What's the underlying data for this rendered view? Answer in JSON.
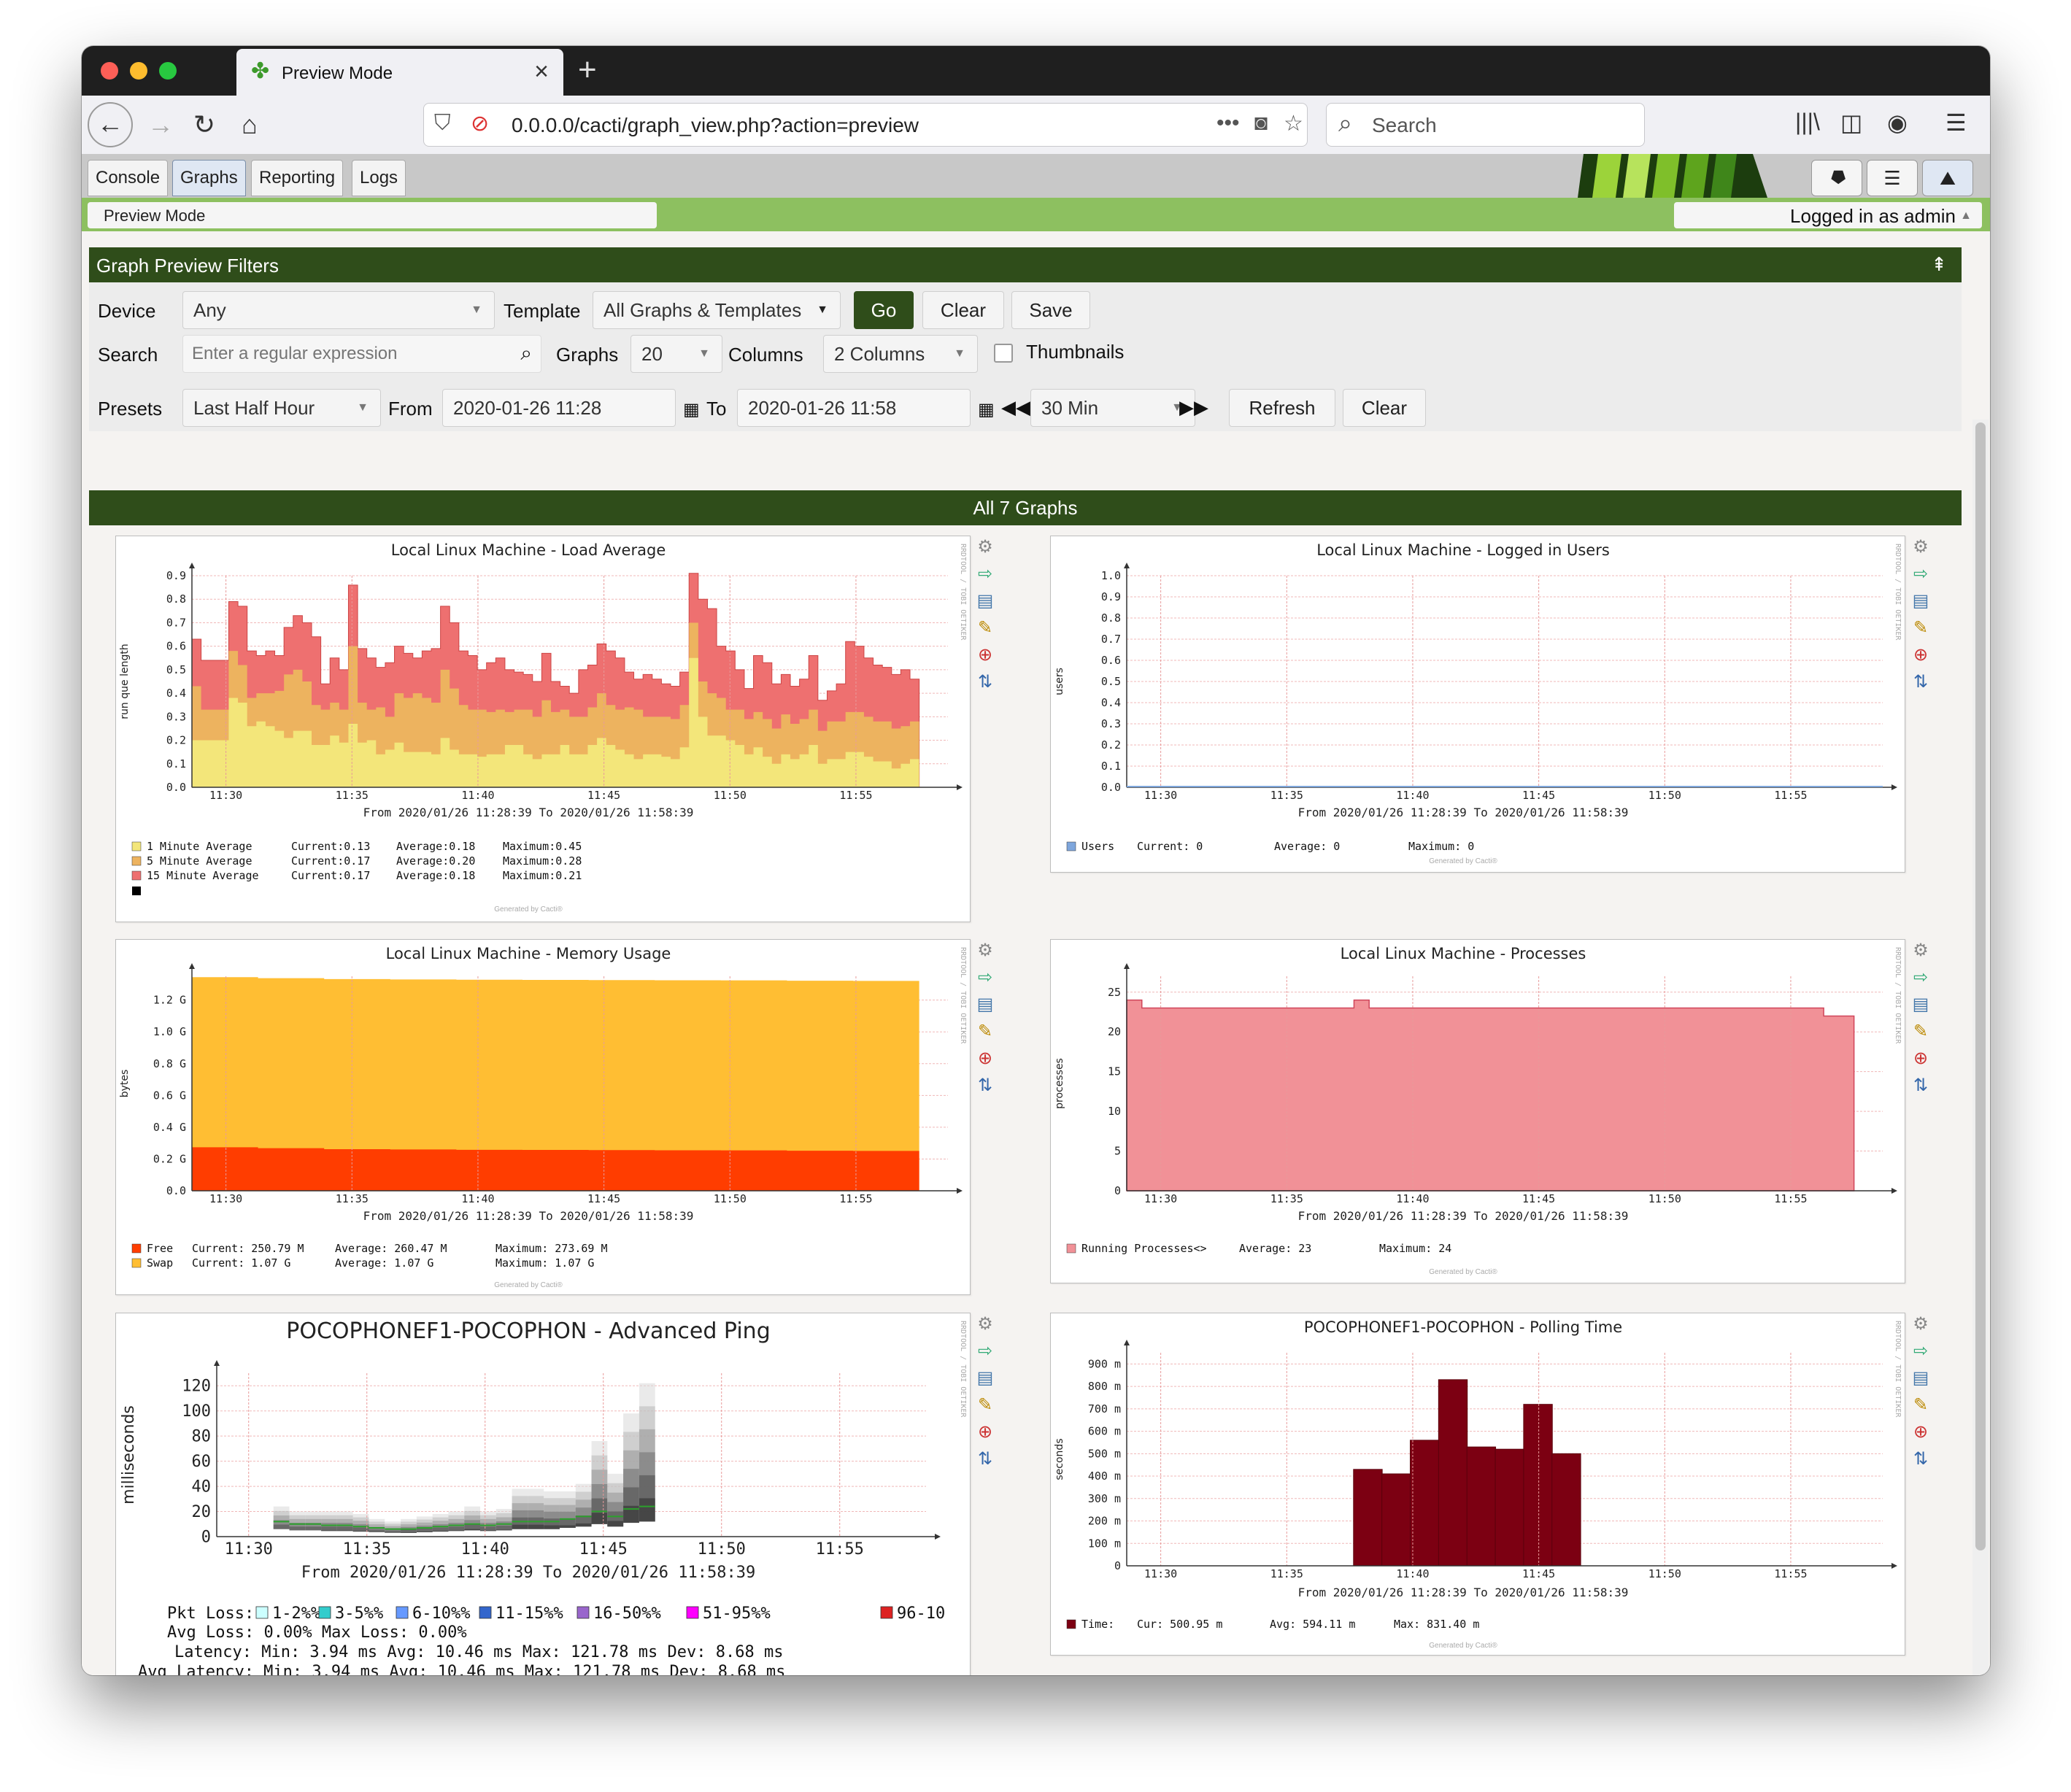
{
  "browser": {
    "tab_title": "Preview Mode",
    "url": "0.0.0.0/cacti/graph_view.php?action=preview",
    "search_placeholder": "Search"
  },
  "cacti": {
    "tabs": [
      "Console",
      "Graphs",
      "Reporting",
      "Logs"
    ],
    "active_tab": "Graphs",
    "breadcrumb": "Preview Mode",
    "login_text": "Logged in as admin"
  },
  "filters": {
    "title": "Graph Preview Filters",
    "device_label": "Device",
    "device_value": "Any",
    "template_label": "Template",
    "template_value": "All Graphs & Templates",
    "go_label": "Go",
    "clear_label": "Clear",
    "save_label": "Save",
    "search_label": "Search",
    "search_placeholder": "Enter a regular expression",
    "graphs_label": "Graphs",
    "graphs_value": "20",
    "columns_label": "Columns",
    "columns_value": "2 Columns",
    "thumbnails_label": "Thumbnails",
    "presets_label": "Presets",
    "presets_value": "Last Half Hour",
    "from_label": "From",
    "from_value": "2020-01-26 11:28",
    "to_label": "To",
    "to_value": "2020-01-26 11:58",
    "span_value": "30 Min",
    "refresh_label": "Refresh",
    "clear2_label": "Clear"
  },
  "graphs_header": "All 7 Graphs",
  "common": {
    "x_ticks": [
      "11:30",
      "11:35",
      "11:40",
      "11:45",
      "11:50",
      "11:55"
    ],
    "range_text": "From 2020/01/26 11:28:39 To 2020/01/26 11:58:39",
    "generated": "Generated by Cacti®",
    "rrdtool": "RRDTOOL / TOBI OETIKER"
  },
  "colors": {
    "load_1": "#F3E67A",
    "load_5": "#EDB35F",
    "load_15": "#EE7070",
    "users": "#7EA6DC",
    "mem_free": "#FF3D00",
    "mem_swap": "#FFBE33",
    "proc": "#F19197",
    "poll": "#7C0012",
    "header_green": "#2F4D1A",
    "bar_green": "#8DC060"
  },
  "chart_data": [
    {
      "type": "area",
      "title": "Local Linux Machine - Load Average",
      "ylabel": "run que length",
      "y_ticks": [
        "0.0",
        "0.1",
        "0.2",
        "0.3",
        "0.4",
        "0.5",
        "0.6",
        "0.7",
        "0.8",
        "0.9"
      ],
      "ylim": [
        0,
        0.9
      ],
      "series": [
        {
          "name": "15 Minute Average",
          "values": [
            0.63,
            0.54,
            0.54,
            0.54,
            0.79,
            0.77,
            0.58,
            0.56,
            0.58,
            0.56,
            0.68,
            0.73,
            0.7,
            0.64,
            0.44,
            0.55,
            0.5,
            0.86,
            0.59,
            0.55,
            0.51,
            0.53,
            0.6,
            0.57,
            0.55,
            0.58,
            0.59,
            0.77,
            0.7,
            0.58,
            0.56,
            0.5,
            0.53,
            0.55,
            0.5,
            0.49,
            0.48,
            0.45,
            0.57,
            0.45,
            0.43,
            0.4,
            0.5,
            0.52,
            0.61,
            0.58,
            0.55,
            0.49,
            0.46,
            0.48,
            0.46,
            0.44,
            0.43,
            0.49,
            0.91,
            0.8,
            0.76,
            0.6,
            0.58,
            0.5,
            0.42,
            0.56,
            0.53,
            0.44,
            0.48,
            0.43,
            0.46,
            0.56,
            0.37,
            0.41,
            0.44,
            0.62,
            0.6,
            0.55,
            0.52,
            0.51,
            0.48,
            0.5,
            0.46
          ]
        },
        {
          "name": "5 Minute Average",
          "values": [
            0.43,
            0.33,
            0.33,
            0.33,
            0.58,
            0.52,
            0.38,
            0.4,
            0.4,
            0.41,
            0.48,
            0.5,
            0.45,
            0.35,
            0.33,
            0.36,
            0.33,
            0.6,
            0.36,
            0.33,
            0.34,
            0.3,
            0.4,
            0.38,
            0.4,
            0.38,
            0.36,
            0.5,
            0.42,
            0.35,
            0.33,
            0.33,
            0.32,
            0.33,
            0.32,
            0.33,
            0.33,
            0.3,
            0.37,
            0.32,
            0.33,
            0.3,
            0.3,
            0.34,
            0.4,
            0.35,
            0.33,
            0.34,
            0.33,
            0.3,
            0.3,
            0.3,
            0.29,
            0.35,
            0.7,
            0.45,
            0.4,
            0.38,
            0.33,
            0.33,
            0.29,
            0.32,
            0.29,
            0.25,
            0.31,
            0.27,
            0.29,
            0.33,
            0.24,
            0.28,
            0.28,
            0.32,
            0.32,
            0.3,
            0.28,
            0.28,
            0.25,
            0.26,
            0.28
          ]
        },
        {
          "name": "1 Minute Average",
          "values": [
            0.2,
            0.2,
            0.2,
            0.2,
            0.38,
            0.36,
            0.26,
            0.28,
            0.26,
            0.24,
            0.21,
            0.24,
            0.24,
            0.18,
            0.18,
            0.22,
            0.19,
            0.27,
            0.19,
            0.2,
            0.14,
            0.16,
            0.19,
            0.15,
            0.15,
            0.15,
            0.14,
            0.21,
            0.16,
            0.14,
            0.14,
            0.13,
            0.14,
            0.14,
            0.18,
            0.18,
            0.14,
            0.12,
            0.14,
            0.14,
            0.18,
            0.14,
            0.14,
            0.18,
            0.21,
            0.18,
            0.16,
            0.14,
            0.12,
            0.14,
            0.14,
            0.13,
            0.12,
            0.17,
            0.55,
            0.3,
            0.22,
            0.22,
            0.2,
            0.18,
            0.14,
            0.17,
            0.13,
            0.1,
            0.14,
            0.12,
            0.14,
            0.18,
            0.1,
            0.12,
            0.12,
            0.15,
            0.15,
            0.13,
            0.11,
            0.11,
            0.08,
            0.1,
            0.12
          ]
        }
      ],
      "legend": [
        {
          "label": "1 Minute Average",
          "current": "0.13",
          "average": "0.18",
          "maximum": "0.45"
        },
        {
          "label": "5 Minute Average",
          "current": "0.17",
          "average": "0.20",
          "maximum": "0.28"
        },
        {
          "label": "15 Minute Average",
          "current": "0.17",
          "average": "0.18",
          "maximum": "0.21"
        }
      ]
    },
    {
      "type": "line",
      "title": "Local Linux Machine - Logged in Users",
      "ylabel": "users",
      "y_ticks": [
        "0.0",
        "0.1",
        "0.2",
        "0.3",
        "0.4",
        "0.5",
        "0.6",
        "0.7",
        "0.8",
        "0.9",
        "1.0"
      ],
      "ylim": [
        0,
        1.0
      ],
      "series": [
        {
          "name": "Users",
          "values": [
            0,
            0
          ]
        }
      ],
      "legend": {
        "label": "Users",
        "current": "0",
        "average": "0",
        "maximum": "0"
      }
    },
    {
      "type": "area",
      "title": "Local Linux Machine - Memory Usage",
      "ylabel": "bytes",
      "y_ticks": [
        "0.0",
        "0.2 G",
        "0.4 G",
        "0.6 G",
        "0.8 G",
        "1.0 G",
        "1.2 G"
      ],
      "ylim": [
        0,
        1.35
      ],
      "series": [
        {
          "name": "Free",
          "values": [
            0.274,
            0.268,
            0.262,
            0.26,
            0.258,
            0.257,
            0.256,
            0.255,
            0.254,
            0.252,
            0.251
          ]
        },
        {
          "name": "Swap",
          "values": [
            1.07,
            1.07,
            1.07,
            1.07,
            1.07,
            1.07,
            1.07,
            1.07,
            1.07,
            1.07,
            1.07
          ]
        }
      ],
      "legend": [
        {
          "label": "Free",
          "current": "250.79 M",
          "average": "260.47 M",
          "maximum": "273.69 M"
        },
        {
          "label": "Swap",
          "current": "1.07 G",
          "average": "1.07 G",
          "maximum": "1.07 G"
        }
      ]
    },
    {
      "type": "area",
      "title": "Local Linux Machine - Processes",
      "ylabel": "processes",
      "y_ticks": [
        "0",
        "5",
        "10",
        "15",
        "20",
        "25"
      ],
      "ylim": [
        0,
        27
      ],
      "series": [
        {
          "name": "Running Processes<>",
          "values": [
            24,
            23,
            23,
            23,
            23,
            23,
            23,
            23,
            23,
            23,
            23,
            23,
            23,
            23,
            23,
            24,
            23,
            23,
            23,
            23,
            23,
            23,
            23,
            23,
            23,
            23,
            23,
            23,
            23,
            23,
            23,
            23,
            23,
            23,
            23,
            23,
            23,
            23,
            23,
            23,
            23,
            23,
            23,
            23,
            23,
            23,
            22,
            22
          ]
        }
      ],
      "legend": {
        "label": "Running Processes<>",
        "average": "23",
        "maximum": "24"
      }
    },
    {
      "type": "bar",
      "title": "POCOPHONEF1-POCOPHON - Advanced Ping",
      "ylabel": "milliseconds",
      "y_ticks": [
        "0",
        "20",
        "40",
        "60",
        "80",
        "100",
        "120"
      ],
      "ylim": [
        0,
        130
      ],
      "latency_max": [
        24,
        20,
        20,
        20,
        20,
        18,
        14,
        12,
        14,
        16,
        18,
        20,
        24,
        20,
        22,
        38,
        38,
        36,
        36,
        42,
        76,
        50,
        98,
        122
      ],
      "latency_avg": [
        12,
        10,
        10,
        9,
        9,
        8,
        7,
        6,
        6,
        7,
        8,
        9,
        10,
        9,
        10,
        12,
        12,
        12,
        14,
        16,
        20,
        16,
        22,
        24
      ],
      "legend": {
        "pkt_loss_label": "Pkt Loss:",
        "pkt_loss_items": [
          "1-2%%",
          "3-5%%",
          "6-10%%",
          "11-15%%",
          "16-50%%",
          "51-95%%",
          "96-10"
        ],
        "pkt_loss_colors": [
          "#CCFFFF",
          "#33CCCC",
          "#6699FF",
          "#3366CC",
          "#9966CC",
          "#FF00FF",
          "#DD2222"
        ],
        "avg_loss": "Avg Loss:  0.00%   Max Loss:  0.00%",
        "latency": "Latency:  Min:    3.94 ms   Avg:   10.46 ms   Max:  121.78 ms   Dev:    8.68 ms",
        "avg_latency": "Avg Latency:  Min:    3.94 ms   Avg:   10.46 ms   Max:  121.78 ms   Dev:    8.68 ms"
      }
    },
    {
      "type": "bar",
      "title": "POCOPHONEF1-POCOPHON - Polling Time",
      "ylabel": "seconds",
      "y_ticks": [
        "0",
        "100 m",
        "200 m",
        "300 m",
        "400 m",
        "500 m",
        "600 m",
        "700 m",
        "800 m",
        "900 m"
      ],
      "ylim": [
        0,
        950
      ],
      "values": [
        430,
        410,
        560,
        830,
        530,
        520,
        720,
        500
      ],
      "legend": {
        "label": "Time:",
        "cur": "500.95 m",
        "avg": "594.11 m",
        "max": "831.40 m"
      }
    }
  ]
}
